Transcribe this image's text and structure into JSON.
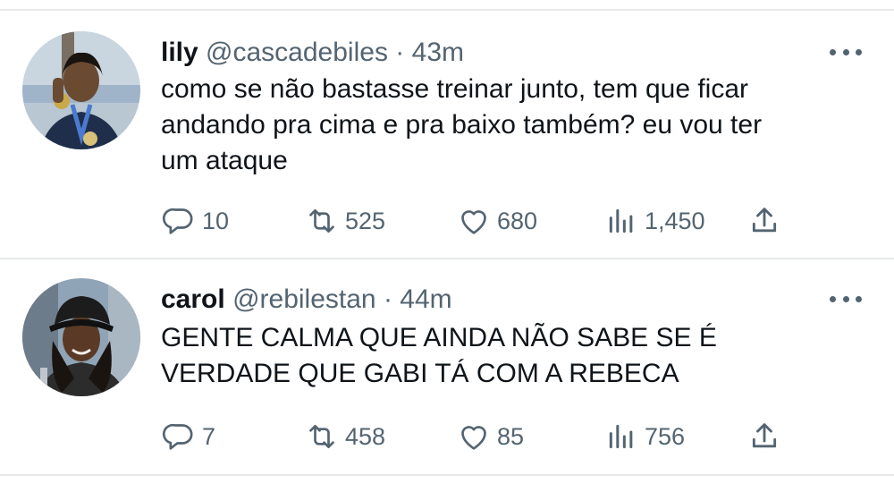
{
  "tweets": [
    {
      "display_name": "lily",
      "handle": "@cascadebiles",
      "separator": "·",
      "time": "43m",
      "text_lines": [
        "como se não bastasse treinar junto, tem que ficar",
        "andando pra cima e pra baixo também? eu vou ter",
        "um ataque"
      ],
      "replies": "10",
      "retweets": "525",
      "likes": "680",
      "views": "1,450"
    },
    {
      "display_name": "carol",
      "handle": "@rebilestan",
      "separator": "·",
      "time": "44m",
      "text_lines": [
        "GENTE CALMA QUE AINDA NÃO SABE SE É",
        "VERDADE QUE GABI TÁ COM A REBECA"
      ],
      "replies": "7",
      "retweets": "458",
      "likes": "85",
      "views": "756"
    }
  ],
  "icons": {
    "reply": "reply-icon",
    "retweet": "retweet-icon",
    "like": "heart-icon",
    "views": "views-icon",
    "share": "share-icon",
    "more": "more-icon"
  },
  "colors": {
    "text": "#0f1419",
    "secondary": "#536471",
    "divider": "#e6e8ea"
  }
}
